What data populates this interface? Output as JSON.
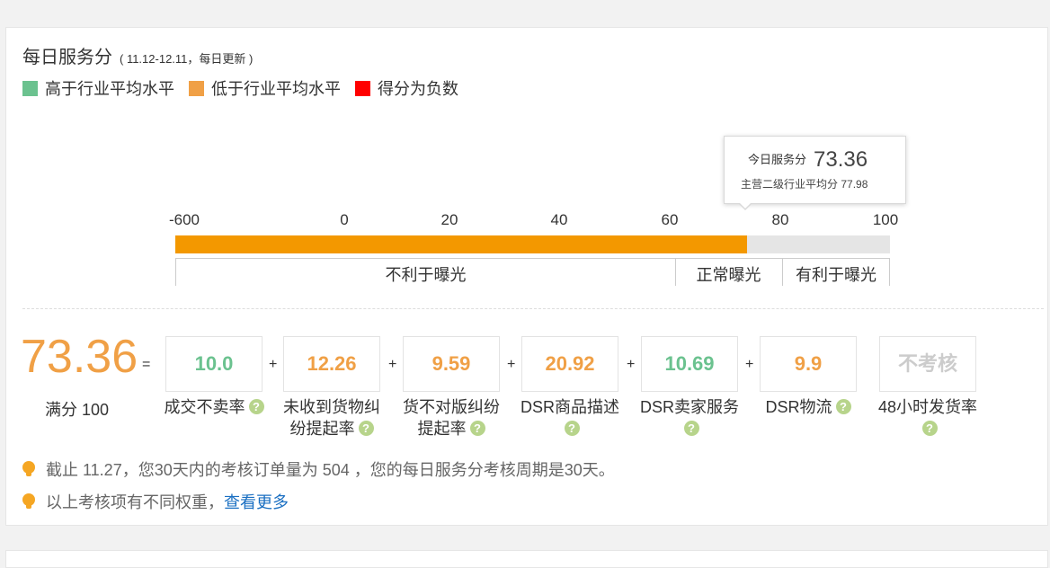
{
  "header": {
    "title": "每日服务分",
    "date_range": "( 11.12-12.11，每日更新  )"
  },
  "legend": [
    {
      "label": "高于行业平均水平",
      "color": "#6bc28f"
    },
    {
      "label": "低于行业平均水平",
      "color": "#f0a046"
    },
    {
      "label": "得分为负数",
      "color": "#ff0000"
    }
  ],
  "scale": {
    "ticks": [
      "-600",
      "0",
      "20",
      "40",
      "60",
      "80",
      "100"
    ],
    "score_value": 73.36,
    "zones": [
      "不利于曝光",
      "正常曝光",
      "有利于曝光"
    ],
    "bar_colors": {
      "fill": "#f39800",
      "track": "#e5e5e5"
    }
  },
  "tooltip": {
    "today_label": "今日服务分",
    "today_value": "73.36",
    "industry_label": "主营二级行业平均分",
    "industry_value": "77.98"
  },
  "summary": {
    "total_score": "73.36",
    "equals": "=",
    "full_label": "满分 100"
  },
  "metrics": [
    {
      "value": "10.0",
      "label_line1": "成交不卖率",
      "label_line2": "",
      "status": "green"
    },
    {
      "value": "12.26",
      "label_line1": "未收到货物纠",
      "label_line2": "纷提起率",
      "status": "orange"
    },
    {
      "value": "9.59",
      "label_line1": "货不对版纠纷",
      "label_line2": "提起率",
      "status": "orange"
    },
    {
      "value": "20.92",
      "label_line1": "DSR商品描述",
      "label_line2": "",
      "status": "orange"
    },
    {
      "value": "10.69",
      "label_line1": "DSR卖家服务",
      "label_line2": "",
      "status": "green"
    },
    {
      "value": "9.9",
      "label_line1": "DSR物流",
      "label_line2": "",
      "status": "orange"
    },
    {
      "value": "不考核",
      "label_line1": "48小时发货率",
      "label_line2": "",
      "status": "grey"
    }
  ],
  "plus_sign": "+",
  "help_glyph": "?",
  "notes": {
    "line1_prefix": "截止 11.27，您30天内的考核订单量为 504 ，您的每日服务分考核周期是30天。",
    "line2_prefix": "以上考核项有不同权重，",
    "line2_link": "查看更多"
  }
}
